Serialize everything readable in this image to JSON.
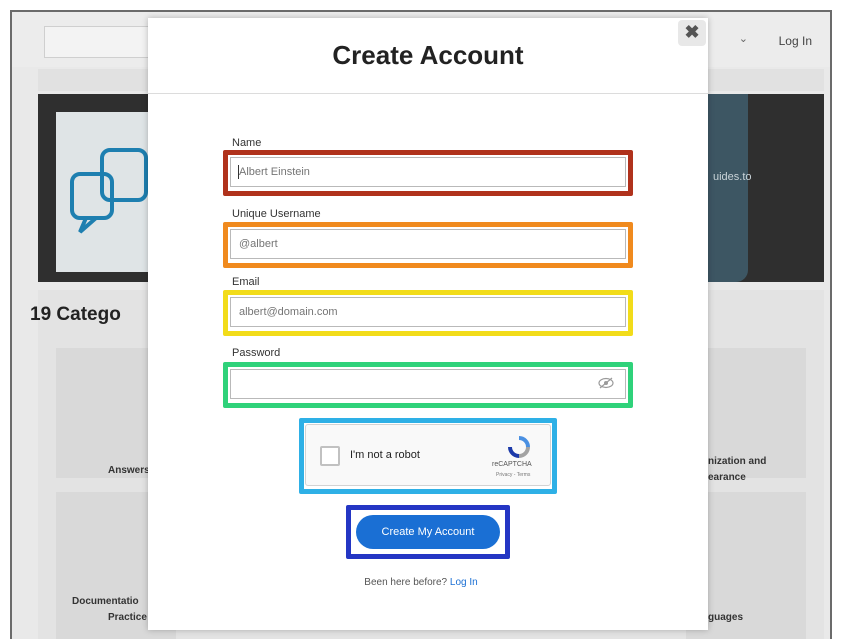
{
  "background": {
    "login_label": "Log In",
    "hero_text": "uides.to",
    "categories_title": "19 Catego",
    "tiles": [
      {
        "label": "Answers"
      },
      {
        "label": "nization and"
      },
      {
        "label": "earance"
      },
      {
        "label": "Documentatio"
      },
      {
        "label": "Practice"
      },
      {
        "label": "guages"
      }
    ]
  },
  "modal": {
    "title": "Create Account",
    "close_glyph": "✖",
    "fields": {
      "name": {
        "label": "Name",
        "placeholder": "Albert Einstein"
      },
      "username": {
        "label": "Unique Username",
        "placeholder": "@albert"
      },
      "email": {
        "label": "Email",
        "placeholder": "albert@domain.com"
      },
      "password": {
        "label": "Password",
        "value": ""
      }
    },
    "captcha": {
      "label": "I'm not a robot",
      "brand": "reCAPTCHA",
      "links": "Privacy - Terms"
    },
    "submit_label": "Create My Account",
    "footer_prompt": "Been here before?",
    "footer_link": "Log In"
  },
  "highlight_colors": {
    "name": "#b0321c",
    "username": "#f08a1e",
    "email": "#f2dc1a",
    "password": "#2fd27a",
    "captcha": "#2eb0e6",
    "submit": "#2436c4"
  },
  "accent": "#1a6fd4"
}
